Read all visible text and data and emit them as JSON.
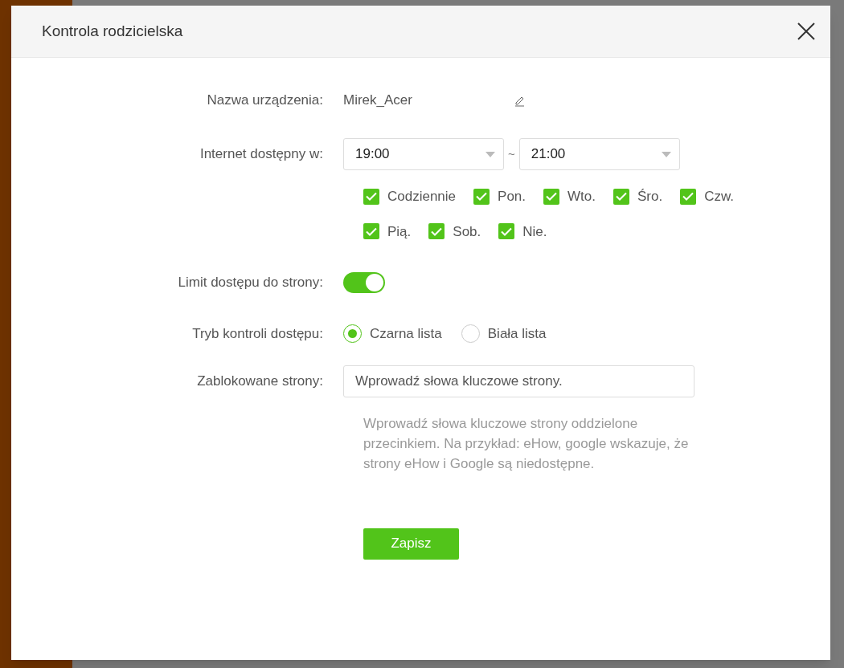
{
  "dialog": {
    "title": "Kontrola rodzicielska"
  },
  "device_name": {
    "label": "Nazwa urządzenia:",
    "value": "Mirek_Acer"
  },
  "internet_time": {
    "label": "Internet dostępny w:",
    "start": "19:00",
    "separator": "~",
    "end": "21:00"
  },
  "days": [
    {
      "label": "Codziennie",
      "checked": true
    },
    {
      "label": "Pon.",
      "checked": true
    },
    {
      "label": "Wto.",
      "checked": true
    },
    {
      "label": "Śro.",
      "checked": true
    },
    {
      "label": "Czw.",
      "checked": true
    },
    {
      "label": "Pią.",
      "checked": true
    },
    {
      "label": "Sob.",
      "checked": true
    },
    {
      "label": "Nie.",
      "checked": true
    }
  ],
  "site_limit": {
    "label": "Limit dostępu do strony:",
    "on": true
  },
  "access_mode": {
    "label": "Tryb kontroli dostępu:",
    "options": [
      {
        "label": "Czarna lista",
        "selected": true
      },
      {
        "label": "Biała lista",
        "selected": false
      }
    ]
  },
  "blocked_sites": {
    "label": "Zablokowane strony:",
    "placeholder": "Wprowadź słowa kluczowe strony.",
    "hint": "Wprowadź słowa kluczowe strony oddzielone przecinkiem. Na przykład: eHow, google wskazuje, że strony eHow i Google są niedostępne."
  },
  "save_button": "Zapisz"
}
